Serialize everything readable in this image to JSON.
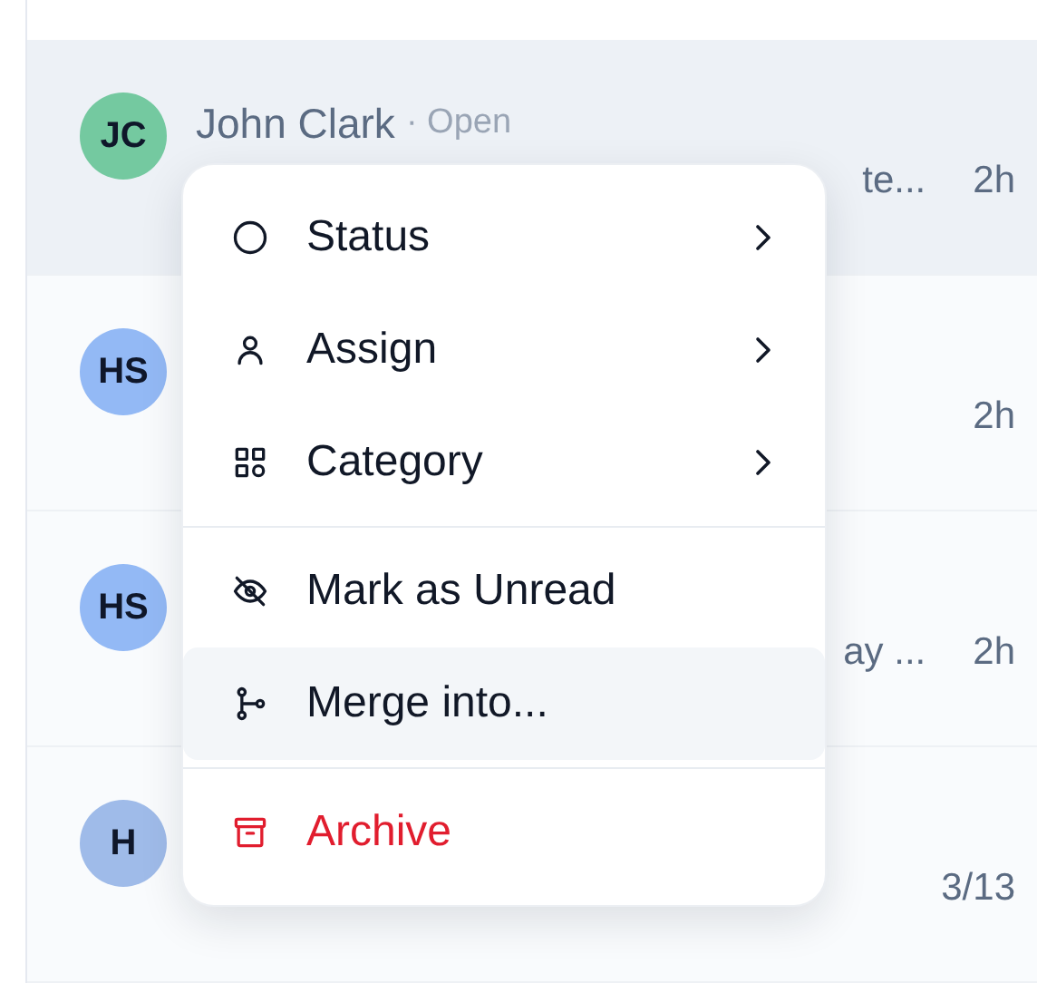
{
  "conversations": [
    {
      "initials": "JC",
      "color": "#74c9a0",
      "name": "John Clark",
      "status": "· Open",
      "preview": "te...",
      "time": "2h",
      "selected": true
    },
    {
      "initials": "HS",
      "color": "#93b9f5",
      "time": "2h",
      "selected": false
    },
    {
      "initials": "HS",
      "color": "#93b9f5",
      "preview": "ay ...",
      "time": "2h",
      "selected": false
    },
    {
      "initials": "H",
      "color": "#9fbbe9",
      "time": "3/13",
      "selected": false
    }
  ],
  "context_menu": {
    "groups": [
      [
        {
          "label": "Status",
          "kind": "submenu",
          "highlighted": false
        },
        {
          "label": "Assign",
          "kind": "submenu",
          "highlighted": false
        },
        {
          "label": "Category",
          "kind": "submenu",
          "highlighted": false
        }
      ],
      [
        {
          "label": "Mark as Unread",
          "kind": "action",
          "highlighted": false
        },
        {
          "label": "Merge into...",
          "kind": "action",
          "highlighted": true
        }
      ],
      [
        {
          "label": "Archive",
          "kind": "danger",
          "highlighted": false
        }
      ]
    ]
  }
}
